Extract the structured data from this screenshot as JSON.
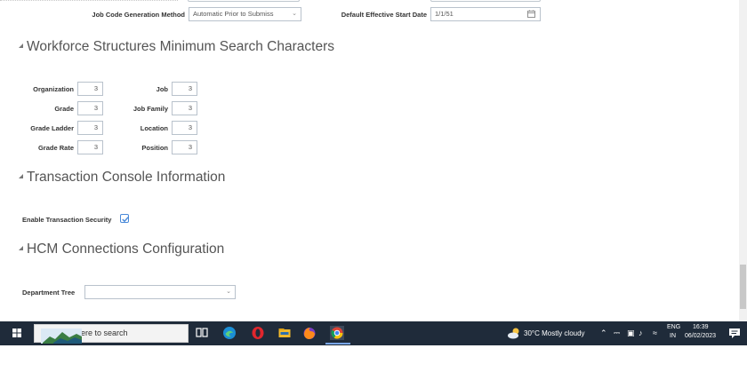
{
  "form": {
    "job_code_generation_method": {
      "label": "Job Code Generation Method",
      "value": "Automatic Prior to Submiss"
    },
    "default_effective_start_date": {
      "label": "Default Effective Start Date",
      "value": "1/1/51"
    }
  },
  "sections": {
    "workforce": {
      "title": "Workforce Structures Minimum Search Characters",
      "fields": [
        {
          "label": "Organization",
          "value": "3"
        },
        {
          "label": "Job",
          "value": "3"
        },
        {
          "label": "Grade",
          "value": "3"
        },
        {
          "label": "Job Family",
          "value": "3"
        },
        {
          "label": "Grade Ladder",
          "value": "3"
        },
        {
          "label": "Location",
          "value": "3"
        },
        {
          "label": "Grade Rate",
          "value": "3"
        },
        {
          "label": "Position",
          "value": "3"
        }
      ]
    },
    "transaction": {
      "title": "Transaction Console Information",
      "enable_security_label": "Enable Transaction Security",
      "enable_security_checked": true
    },
    "hcm": {
      "title": "HCM Connections Configuration",
      "department_tree_label": "Department Tree",
      "department_tree_value": ""
    }
  },
  "taskbar": {
    "search_placeholder": "Type here to search",
    "weather": "30°C  Mostly cloudy",
    "lang_top": "ENG",
    "lang_bottom": "IN",
    "time": "16:39",
    "date": "06/02/2023"
  },
  "colors": {
    "taskbar_bg": "#1f2b3a",
    "checkbox_accent": "#4a8ad9"
  }
}
